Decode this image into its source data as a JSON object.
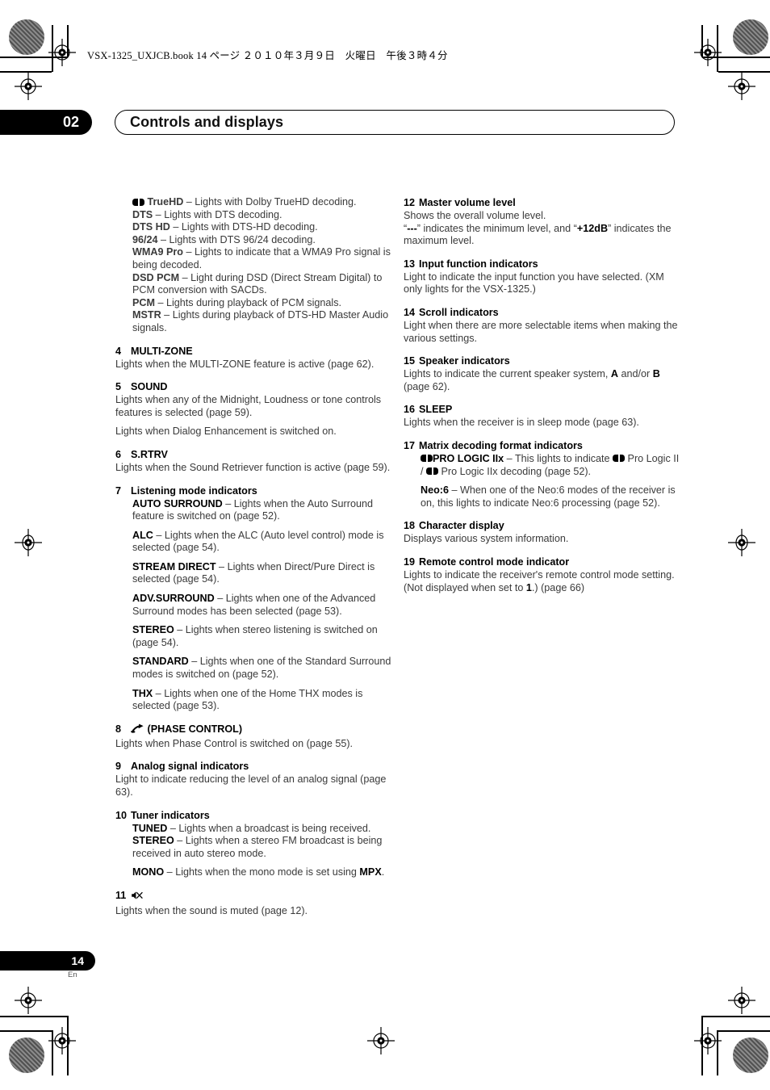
{
  "print_marks": {
    "file_header": "VSX-1325_UXJCB.book   14 ページ   ２０１０年３月９日　火曜日　午後３時４分"
  },
  "chapter": {
    "number": "02",
    "title": "Controls and displays"
  },
  "footer": {
    "page_number": "14",
    "language": "En"
  },
  "left_column": {
    "continued_list": [
      {
        "icon": "dolby-logo",
        "term": "TrueHD",
        "desc": " – Lights with Dolby TrueHD decoding."
      },
      {
        "icon": "",
        "term": "DTS",
        "desc": " – Lights with DTS decoding."
      },
      {
        "icon": "",
        "term": "DTS HD",
        "desc": " – Lights with DTS-HD decoding."
      },
      {
        "icon": "",
        "term": "96/24",
        "desc": " – Lights with DTS 96/24 decoding."
      },
      {
        "icon": "",
        "term": "WMA9 Pro",
        "desc": " – Lights to indicate that a WMA9 Pro signal is being decoded."
      },
      {
        "icon": "",
        "term": "DSD PCM",
        "desc": " – Light during DSD (Direct Stream Digital) to PCM conversion with SACDs."
      },
      {
        "icon": "",
        "term": "PCM",
        "desc": " – Lights during playback of PCM signals."
      },
      {
        "icon": "",
        "term": "MSTR",
        "desc": " – Lights during playback of DTS-HD Master Audio signals."
      }
    ],
    "items": [
      {
        "num": "4",
        "heading": "MULTI-ZONE",
        "paras": [
          "Lights when the MULTI-ZONE feature is active (page 62)."
        ]
      },
      {
        "num": "5",
        "heading": "SOUND",
        "paras": [
          "Lights when any of the Midnight, Loudness or tone controls features is selected (page 59).",
          "Lights when Dialog Enhancement is switched on."
        ]
      },
      {
        "num": "6",
        "heading": "S.RTRV",
        "paras": [
          "Lights when the Sound Retriever function is active (page 59)."
        ]
      },
      {
        "num": "7",
        "heading": "Listening mode indicators",
        "subs": [
          {
            "term": "AUTO SURROUND",
            "desc": " – Lights when the Auto Surround feature is switched on (page 52)."
          },
          {
            "term": "ALC",
            "desc": " – Lights when the ALC (Auto level control) mode is selected (page 54)."
          },
          {
            "term": "STREAM DIRECT",
            "desc": " – Lights when Direct/Pure Direct is selected (page 54)."
          },
          {
            "term": "ADV.SURROUND",
            "desc": " – Lights when one of the Advanced Surround modes has been selected (page 53)."
          },
          {
            "term": "STEREO",
            "desc": " – Lights when stereo listening is switched on (page 54)."
          },
          {
            "term": "STANDARD",
            "desc": " – Lights when one of the Standard Surround modes is switched on (page 52)."
          },
          {
            "term": "THX",
            "desc": " – Lights when one of the Home THX modes is selected (page 53)."
          }
        ]
      },
      {
        "num": "8",
        "heading_icon": "phase-control-icon",
        "heading": "(PHASE CONTROL)",
        "paras": [
          "Lights when Phase Control is switched on (page 55)."
        ]
      },
      {
        "num": "9",
        "heading": "Analog signal indicators",
        "paras": [
          "Light to indicate reducing the level of an analog signal (page 63)."
        ]
      },
      {
        "num": "10",
        "heading": "Tuner indicators",
        "subs": [
          {
            "term": "TUNED",
            "desc": " – Lights when a broadcast is being received."
          },
          {
            "term": "STEREO",
            "desc": " – Lights when a stereo FM broadcast is being received in auto stereo mode."
          },
          {
            "term": "MONO",
            "desc": " – Lights when the mono mode is set using ",
            "desc_bold_tail": "MPX",
            "desc_tail": "."
          }
        ]
      },
      {
        "num": "11",
        "heading_icon": "mute-icon",
        "heading": "",
        "paras": [
          "Lights when the sound is muted (page 12)."
        ]
      }
    ]
  },
  "right_column": {
    "items": [
      {
        "num": "12",
        "heading": "Master volume level",
        "paras": [
          "Shows the overall volume level."
        ],
        "rich_para": {
          "pre": "“",
          "b1": "---",
          "mid": "” indicates the minimum level, and “",
          "b2": "+12dB",
          "post": "” indicates the maximum level."
        }
      },
      {
        "num": "13",
        "heading": "Input function indicators",
        "paras": [
          "Light to indicate the input function you have selected. (XM only lights for the VSX-1325.)"
        ]
      },
      {
        "num": "14",
        "heading": "Scroll indicators",
        "paras": [
          "Light when there are more selectable items when making the various settings."
        ]
      },
      {
        "num": "15",
        "heading": "Speaker indicators",
        "rich_para": {
          "pre": "Lights to indicate the current speaker system, ",
          "b1": "A",
          "mid": " and/or ",
          "b2": "B",
          "post": " (page 62)."
        }
      },
      {
        "num": "16",
        "heading": "SLEEP",
        "paras": [
          "Lights when the receiver is in sleep mode (page 63)."
        ]
      },
      {
        "num": "17",
        "heading": "Matrix decoding format indicators",
        "subs": [
          {
            "icon": "dolby-logo",
            "term": "PRO LOGIC IIx",
            "desc_a": " – This lights to indicate ",
            "icon2": "dolby-logo",
            "desc_b": " Pro Logic II / ",
            "icon3": "dolby-logo",
            "desc_c": " Pro Logic IIx decoding (page 52)."
          },
          {
            "term": "Neo:6",
            "desc": " – When one of the Neo:6 modes of the receiver is on, this lights to indicate Neo:6 processing (page 52)."
          }
        ]
      },
      {
        "num": "18",
        "heading": "Character display",
        "paras": [
          "Displays various system information."
        ]
      },
      {
        "num": "19",
        "heading": "Remote control mode indicator",
        "rich_para": {
          "pre": "Lights to indicate the receiver's remote control mode setting. (Not displayed when set to ",
          "b1": "1",
          "mid": ".) (page 66)",
          "b2": "",
          "post": ""
        }
      }
    ]
  }
}
